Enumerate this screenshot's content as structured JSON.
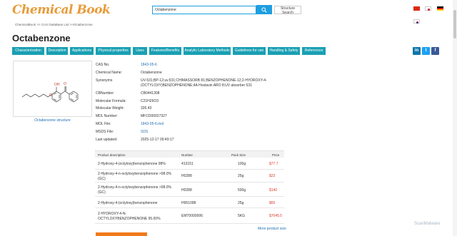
{
  "header": {
    "logo_text": "Chemical Book",
    "search_value": "Octabenzone",
    "structure_search_label": "Structure Search",
    "languages": [
      "cn-flag",
      "jp-flag",
      "de-flag",
      "kr-flag"
    ]
  },
  "breadcrumb": {
    "items": [
      "ChemicalBook",
      ">>",
      "CAS DataBase List",
      ">>",
      "Octabenzone"
    ]
  },
  "page_title": "Octabenzone",
  "tabs": [
    "Characterization",
    "Description",
    "Applications",
    "Physical properties",
    "Uses",
    "Features/Benefits",
    "Analytic Laboratory Methods",
    "Guidelines for use",
    "Handling & Safety",
    "References"
  ],
  "social": {
    "linkedin": "in",
    "twitter": "t",
    "facebook": "f"
  },
  "structure": {
    "caption": "Octabenzone structure"
  },
  "properties": [
    {
      "label": "CAS No.",
      "value": "1843-05-6",
      "link": true
    },
    {
      "label": "Chemical Name:",
      "value": "Octabenzone",
      "link": false
    },
    {
      "label": "Synonyms",
      "value": "UV-531;BP-12;uv.531;CHIMASSORB 81;BENZOPHENONE-12;2-HYDROXY-4-(OCTYLOXY)BENZOPHENONE;4A Hostavin ARO 8;UV absorber 531",
      "link": false
    },
    {
      "label": "CBNumber:",
      "value": "CB0441308",
      "link": false
    },
    {
      "label": "Molecular Formula:",
      "value": "C21H26O3",
      "link": false
    },
    {
      "label": "Molecular Weight:",
      "value": "326.43",
      "link": false
    },
    {
      "label": "MDL Number:",
      "value": "MFCD00027327",
      "link": false
    },
    {
      "label": "MOL File:",
      "value": "1843-05-6.mol",
      "link": true
    },
    {
      "label": "MSDS File:",
      "value": "SDS",
      "link": true
    },
    {
      "label": "Last updated:",
      "value": "2025-12-17 09:49:17",
      "link": false
    }
  ],
  "suppliers": {
    "headers": {
      "description": "Product description",
      "product_number": "Number",
      "pack_size": "Pack Size",
      "price": "Price"
    },
    "rows": [
      {
        "description": "2-Hydroxy-4-(octyloxy)benzophenone 98%",
        "product_number": "413151",
        "pack_size": "100g",
        "price": "$77.7"
      },
      {
        "description": "2-Hydroxy-4-n-octyloxybenzophenone >98.0%(GC)",
        "product_number": "H0288",
        "pack_size": "25g",
        "price": "$23"
      },
      {
        "description": "2-Hydroxy-4-n-octyloxybenzophenone >98.0%(GC)",
        "product_number": "H0288",
        "pack_size": "500g",
        "price": "$140"
      },
      {
        "description": "2-Hydroxy-4-(octyloxy)benzophenone",
        "product_number": "H951098",
        "pack_size": "25g",
        "price": "$65"
      },
      {
        "description": "2-HYDROXY-4-N-OCTYLOXYBENZOPHENONE 95.00%",
        "product_number": "EMT0000006",
        "pack_size": "5KG",
        "price": "$7045.5"
      }
    ],
    "more_label": "More product size"
  },
  "watermark": "ScanMalware"
}
